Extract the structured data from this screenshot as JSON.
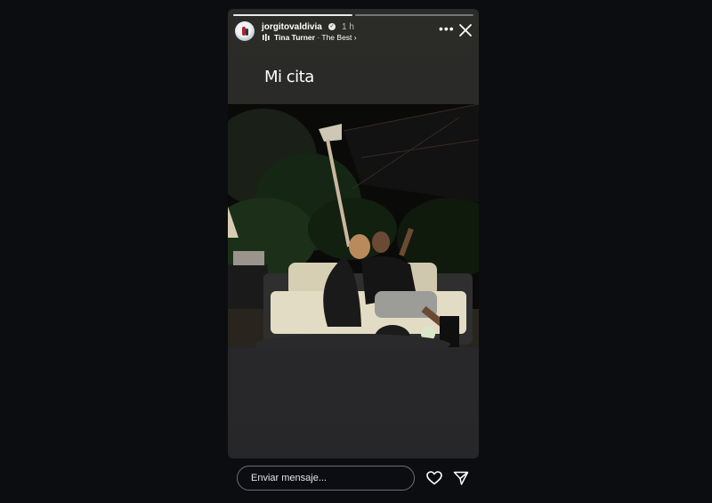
{
  "story": {
    "username": "jorgitovaldivia",
    "time": "1 h",
    "music": {
      "artist": "Tina Turner",
      "song": "The Best"
    },
    "caption": "Mi cita",
    "progress_segments": 2,
    "progress_done": 1
  },
  "icons": {
    "verified": "verified-badge-icon",
    "music": "music-bars-icon",
    "more": "more-options-icon",
    "close": "close-icon",
    "like": "heart-icon",
    "share": "send-icon"
  },
  "footer": {
    "message_placeholder": "Enviar mensaje..."
  }
}
